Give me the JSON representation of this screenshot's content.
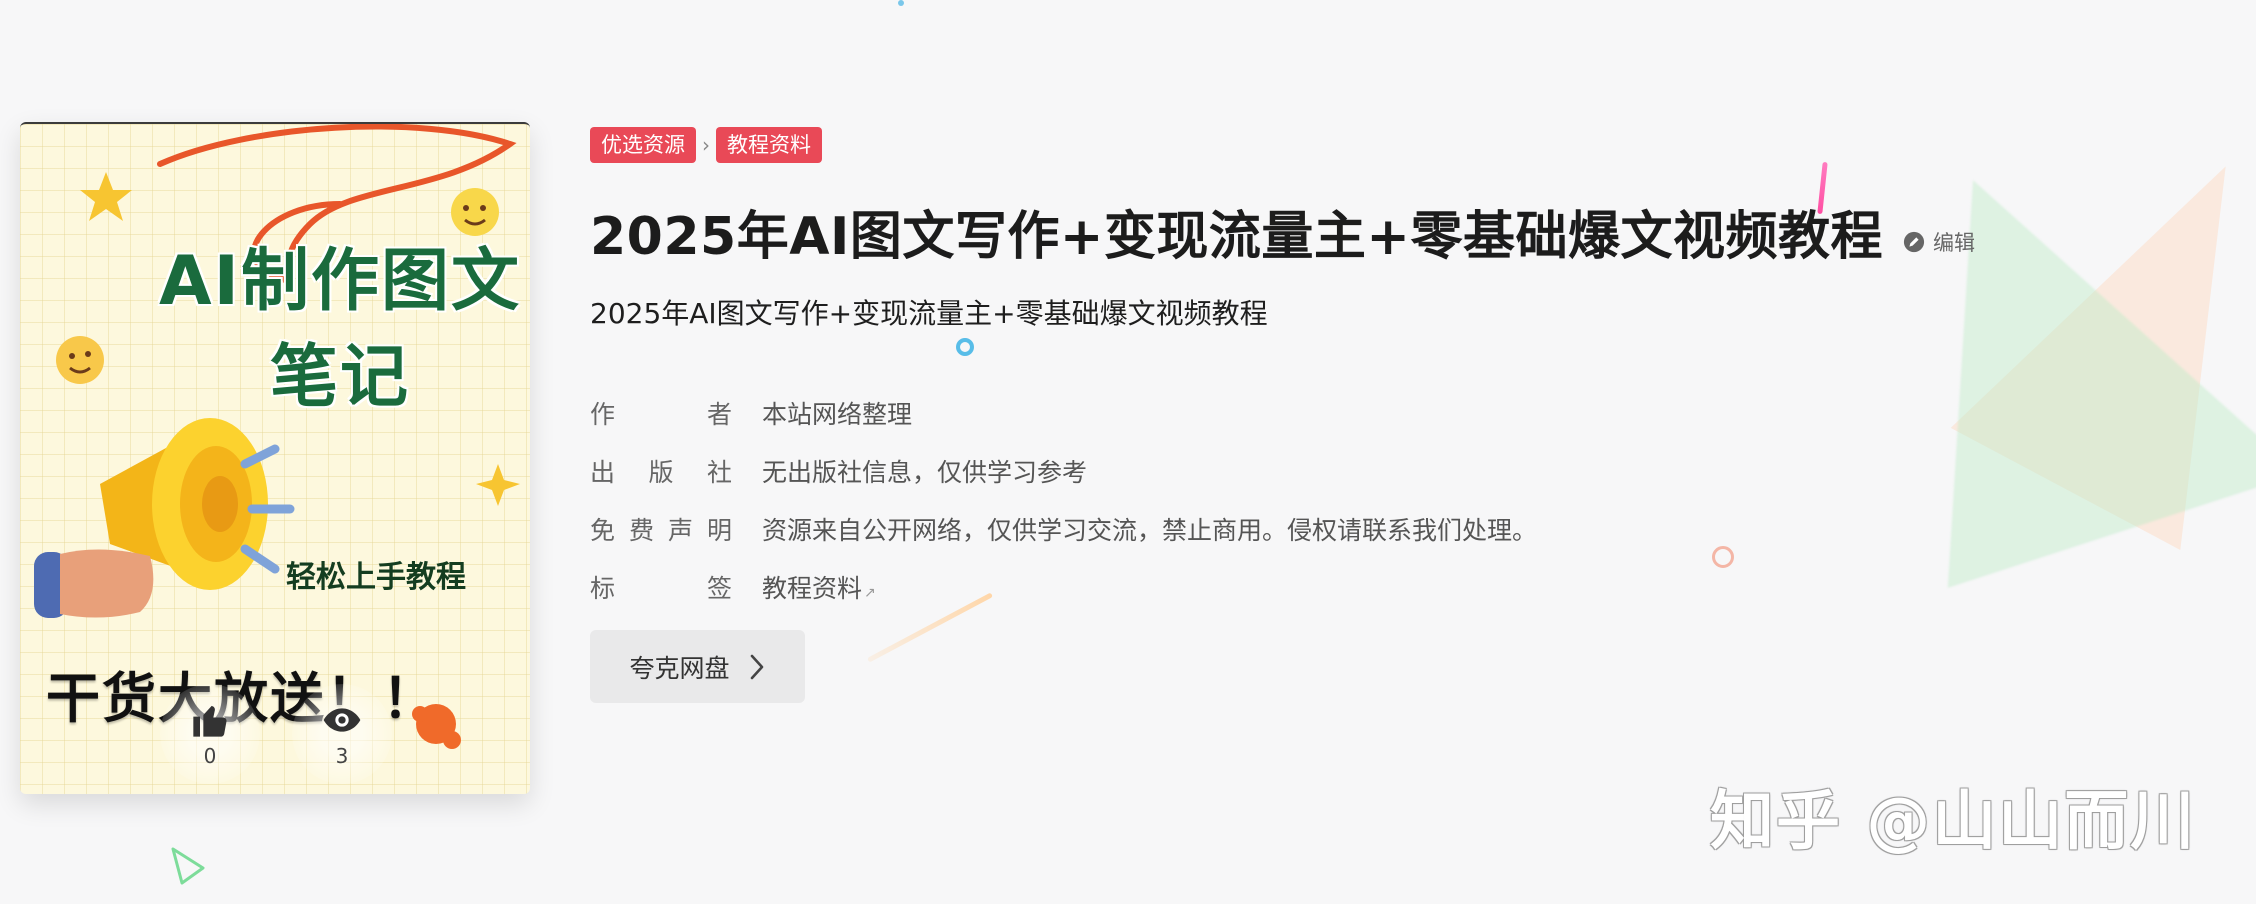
{
  "breadcrumb": {
    "items": [
      "优选资源",
      "教程资料"
    ],
    "separator": "›"
  },
  "header": {
    "title": "2025年AI图文写作+变现流量主+零基础爆文视频教程",
    "edit_label": "编辑"
  },
  "subtitle": "2025年AI图文写作+变现流量主+零基础爆文视频教程",
  "meta": {
    "author": {
      "label": [
        "作",
        "者"
      ],
      "value": "本站网络整理"
    },
    "publisher": {
      "label": [
        "出",
        "版",
        "社"
      ],
      "value": "无出版社信息，仅供学习参考"
    },
    "disclaimer": {
      "label": [
        "免",
        "费",
        "声",
        "明"
      ],
      "value": "资源来自公开网络，仅供学习交流，禁止商用。侵权请联系我们处理。"
    },
    "tags": {
      "label": [
        "标",
        "签"
      ],
      "value": "教程资料"
    }
  },
  "download": {
    "button_label": "夸克网盘",
    "icon": "chevron-right-icon"
  },
  "cover": {
    "title_line1": "AI制作图文",
    "title_line2": "笔记",
    "subtitle": "轻松上手教程",
    "bottom_text": "干货大放送！！",
    "likes": "0",
    "views": "3"
  },
  "watermark": "知乎 @山山而川",
  "colors": {
    "tag_bg": "#e94957",
    "cover_title": "#1a6b3d",
    "button_bg": "#e9e9ea"
  }
}
